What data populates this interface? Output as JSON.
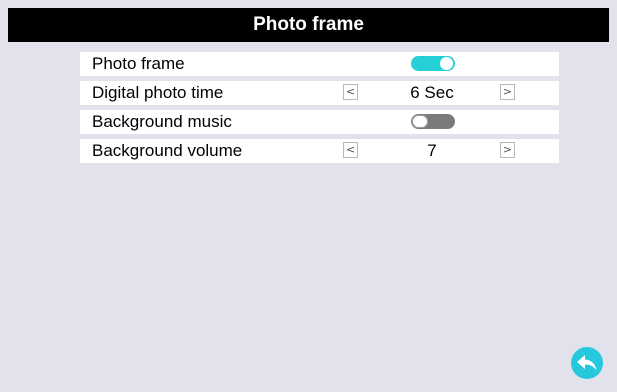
{
  "header": {
    "title": "Photo frame"
  },
  "settings": [
    {
      "label": "Photo frame",
      "control": "toggle",
      "value": true
    },
    {
      "label": "Digital photo time",
      "control": "stepper",
      "value": "6 Sec",
      "prev": "<",
      "next": ">"
    },
    {
      "label": "Background music",
      "control": "toggle",
      "value": false
    },
    {
      "label": "Background volume",
      "control": "stepper",
      "value": "7",
      "prev": "<",
      "next": ">"
    }
  ],
  "footer": {
    "back_icon": "back-arrow-icon"
  },
  "colors": {
    "background": "#e2e2ec",
    "title_bar": "#000000",
    "toggle_on": "#25d0d8",
    "toggle_off": "#7a7a7a",
    "back_button": "#25c8dc"
  }
}
